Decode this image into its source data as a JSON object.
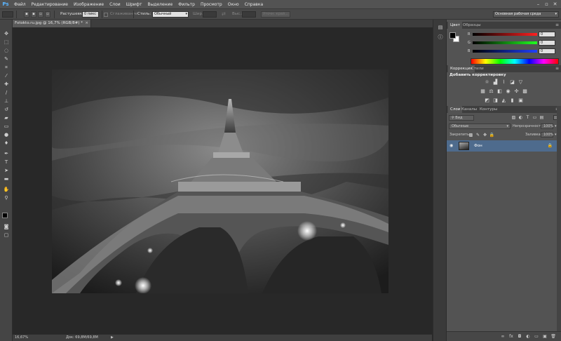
{
  "app": {
    "logo": "Ps"
  },
  "menu": [
    "Файл",
    "Редактирование",
    "Изображение",
    "Слои",
    "Шрифт",
    "Выделение",
    "Фильтр",
    "Просмотр",
    "Окно",
    "Справка"
  ],
  "options": {
    "feather_label": "Растушевка:",
    "feather_value": "0 пикс",
    "antialias_label": "Сглаживание",
    "style_label": "Стиль:",
    "style_value": "Обычный",
    "width_label": "Шир.:",
    "height_label": "Выс.:",
    "refine_button": "Уточн. край...",
    "workspace_value": "Основная рабочая среда"
  },
  "document": {
    "tab_title": "Fotokto.ru.jpg @ 16,7% (RGB/8#) *",
    "zoom": "16,67%",
    "doc_info": "Док: 69,8M/69,8M"
  },
  "color_panel": {
    "tabs": [
      "Цвет",
      "Образцы"
    ],
    "r_label": "R",
    "g_label": "G",
    "b_label": "B",
    "r_value": "0",
    "g_value": "0",
    "b_value": "0"
  },
  "adjust_panel": {
    "tabs": [
      "Коррекция",
      "Стили"
    ],
    "title": "Добавить корректировку"
  },
  "layers_panel": {
    "tabs": [
      "Слои",
      "Каналы",
      "Контуры"
    ],
    "kind_filter": "Вид",
    "blend_mode": "Обычные",
    "opacity_label": "Непрозрачность:",
    "opacity_value": "100%",
    "lock_label": "Закрепить:",
    "fill_label": "Заливка:",
    "fill_value": "100%",
    "layer_name": "Фон"
  },
  "colors": {
    "accent": "#4e6b8d",
    "ps_blue": "#5bb5ff"
  }
}
